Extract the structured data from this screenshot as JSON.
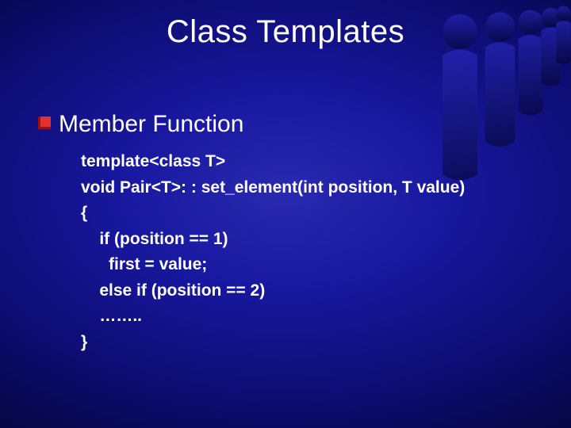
{
  "slide": {
    "title": "Class Templates",
    "heading": "Member Function",
    "code_lines": {
      "l1": "template<class T>",
      "l2": "void Pair<T>: : set_element(int position, T value)",
      "l3": "{",
      "l4": "    if (position == 1)",
      "l5": "      first = value;",
      "l6": "    else if (position == 2)",
      "l7": "    ……..",
      "l8": "}"
    }
  }
}
